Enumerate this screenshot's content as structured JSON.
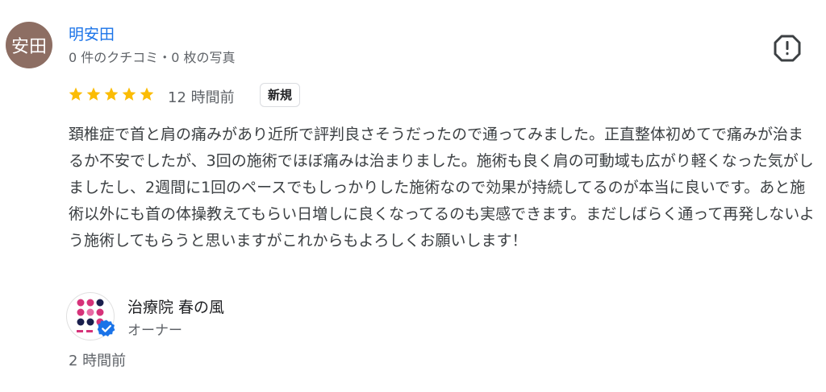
{
  "reviewer": {
    "avatar_text": "安田",
    "avatar_color": "#8d6e63",
    "name": "明安田",
    "meta": "0 件のクチコミ・0 枚の写真"
  },
  "review": {
    "rating": 5,
    "star_color": "#fbbc04",
    "time_ago": "12 時間前",
    "badge": "新規",
    "text": "頚椎症で首と肩の痛みがあり近所で評判良さそうだったので通ってみました。正直整体初めてで痛みが治まるか不安でしたが、3回の施術でほぼ痛みは治まりました。施術も良く肩の可動域も広がり軽くなった気がしましたし、2週間に1回のペースでもしっかりした施術なので効果が持続してるのが本当に良いです。あと施術以外にも首の体操教えてもらい日増しに良くなってるのも実感できます。まだしばらく通って再発しないよう施術してもらうと思いますがこれからもよろしくお願いします！"
  },
  "owner": {
    "name": "治療院 春の風",
    "role": "オーナー",
    "reply_time": "2 時間前"
  },
  "icons": {
    "report": "report-icon",
    "star": "star-icon",
    "verified": "verified-check-icon"
  },
  "colors": {
    "link": "#1a73e8",
    "verified": "#1a73e8",
    "logo_pink": "#d6337a",
    "logo_navy": "#1a1f4d"
  }
}
